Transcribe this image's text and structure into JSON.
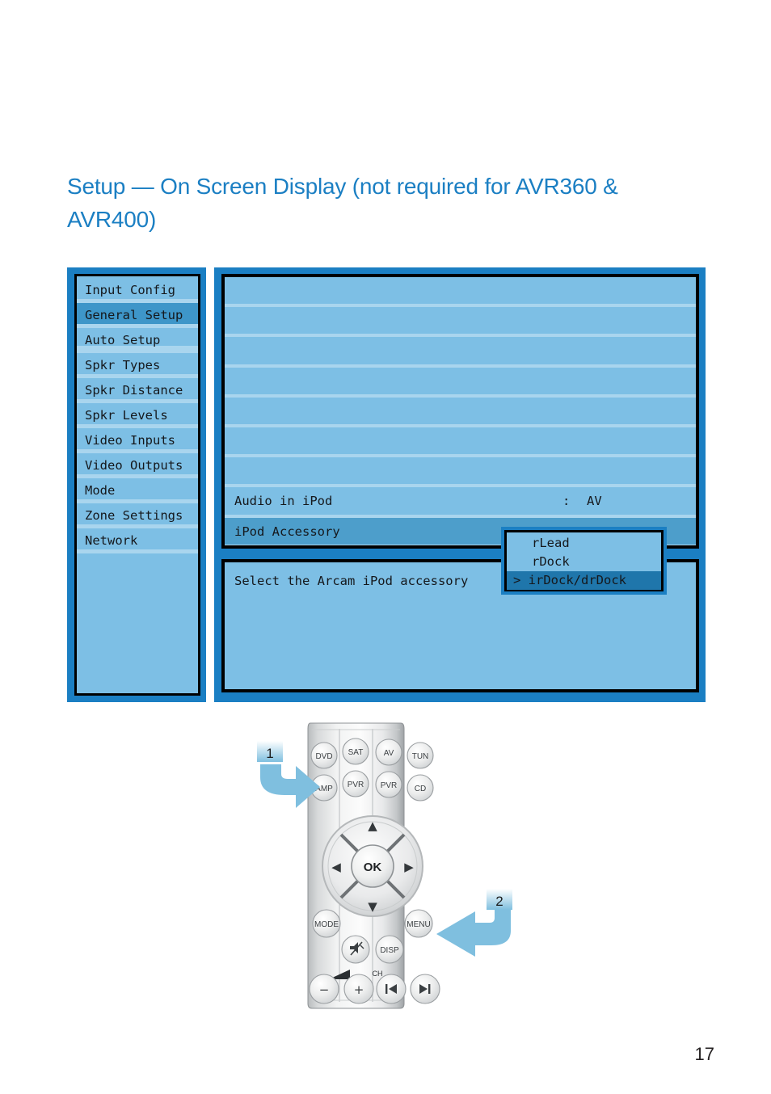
{
  "page": {
    "heading": "Setup — On Screen Display (not required for AVR360 & AVR400)",
    "number": "17"
  },
  "osd": {
    "sidebar": {
      "items": [
        {
          "label": "Input Config",
          "selected": false,
          "group_break": false
        },
        {
          "label": "General Setup",
          "selected": true,
          "group_break": false
        },
        {
          "label": "Auto Setup",
          "selected": false,
          "group_break": true
        },
        {
          "label": "Spkr Types",
          "selected": false,
          "group_break": false
        },
        {
          "label": "Spkr Distance",
          "selected": false,
          "group_break": false
        },
        {
          "label": "Spkr Levels",
          "selected": false,
          "group_break": false
        },
        {
          "label": "Video Inputs",
          "selected": false,
          "group_break": false
        },
        {
          "label": "Video Outputs",
          "selected": false,
          "group_break": false
        },
        {
          "label": "Mode",
          "selected": false,
          "group_break": false
        },
        {
          "label": "Zone Settings",
          "selected": false,
          "group_break": false
        },
        {
          "label": "Network",
          "selected": false,
          "group_break": false
        }
      ]
    },
    "rows": [
      {
        "label": "",
        "sep": "",
        "value": "",
        "highlight": false
      },
      {
        "label": "",
        "sep": "",
        "value": "",
        "highlight": false
      },
      {
        "label": "",
        "sep": "",
        "value": "",
        "highlight": false
      },
      {
        "label": "",
        "sep": "",
        "value": "",
        "highlight": false
      },
      {
        "label": "",
        "sep": "",
        "value": "",
        "highlight": false
      },
      {
        "label": "",
        "sep": "",
        "value": "",
        "highlight": false
      },
      {
        "label": "",
        "sep": "",
        "value": "",
        "highlight": false
      },
      {
        "label": "Audio in iPod",
        "sep": ":",
        "value": "AV",
        "highlight": false
      },
      {
        "label": "iPod Accessory",
        "sep": "",
        "value": "",
        "highlight": true
      }
    ],
    "dropdown": {
      "options": [
        {
          "label": "rLead",
          "selected": false
        },
        {
          "label": "rDock",
          "selected": false
        },
        {
          "label": "> irDock/drDock",
          "selected": true
        }
      ]
    },
    "help": {
      "text": "Select the Arcam iPod accessory"
    },
    "colors": {
      "frame_blue": "#1b7fc3",
      "panel_light_blue": "#7dbfe5",
      "row_divider": "#a9d5ee",
      "highlight_blue": "#4d9ecb",
      "dropdown_selected": "#1f76ab",
      "heading_blue": "#1b7fc3",
      "arrow_blue": "#7fbfdf"
    }
  },
  "remote": {
    "callouts": [
      {
        "label": "1"
      },
      {
        "label": "2"
      }
    ],
    "source_buttons_row1": [
      "DVD",
      "SAT",
      "AV",
      "TUN"
    ],
    "source_buttons_row2": [
      "AMP",
      "PVR",
      "PVR",
      "CD"
    ],
    "navigation": {
      "up": "▲",
      "down": "▼",
      "left": "◀",
      "right": "▶",
      "ok": "OK"
    },
    "lower_buttons": {
      "mode": "MODE",
      "menu": "MENU",
      "mute": "mute-icon",
      "disp": "DISP",
      "volume_down": "−",
      "volume_up": "+",
      "channel_label": "CH",
      "channel_prev": "◀❙",
      "channel_next": "❙▶",
      "volume_label": "volume-wedge-icon"
    }
  }
}
